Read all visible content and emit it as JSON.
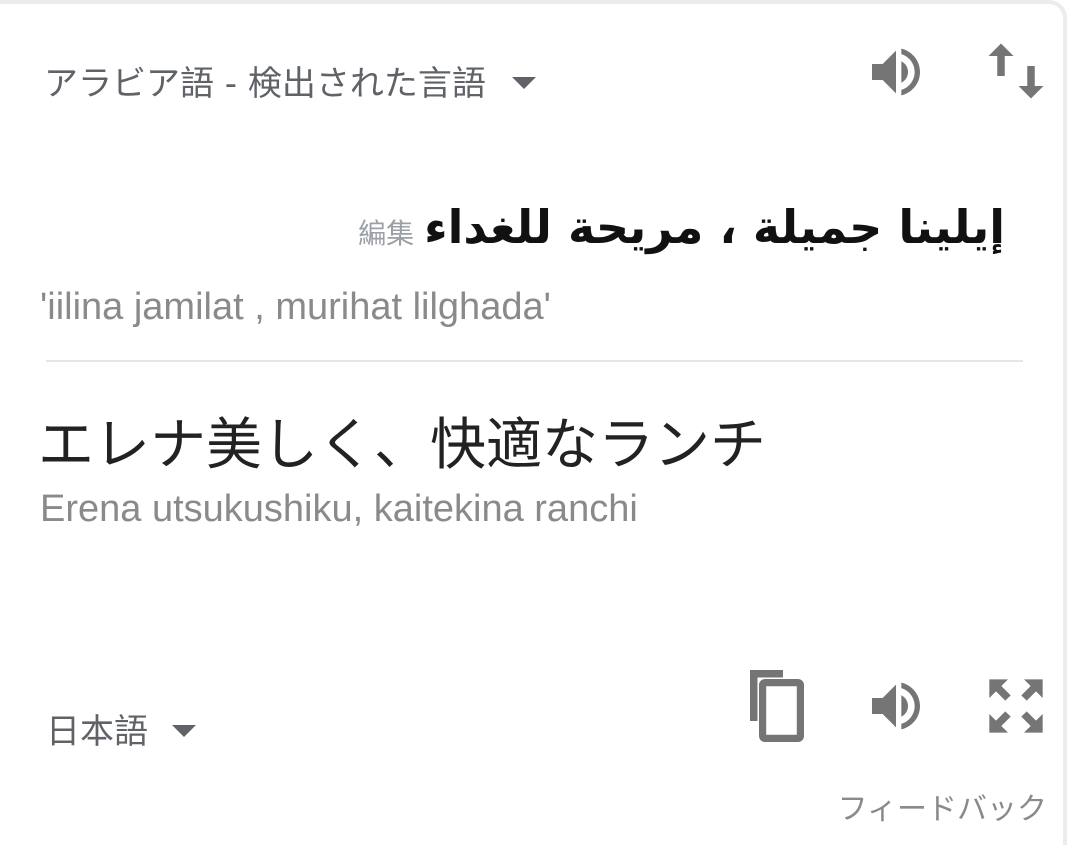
{
  "source": {
    "language_label": "アラビア語 - 検出された言語",
    "text": "إيلينا جميلة ، مريحة للغداء",
    "edit_label": "編集",
    "transliteration": "'iilina jamilat , murihat lilghada'"
  },
  "target": {
    "language_label": "日本語",
    "text": "エレナ美しく、快適なランチ",
    "transliteration": "Erena utsukushiku, kaitekina ranchi"
  },
  "footer": {
    "feedback_label": "フィードバック"
  },
  "icons": {
    "source_speaker": "speaker-icon",
    "swap": "swap-icon",
    "copy": "copy-icon",
    "target_speaker": "speaker-icon",
    "expand": "fullscreen-icon"
  },
  "colors": {
    "icon_gray": "#757575",
    "text_primary": "#222222",
    "text_secondary": "#8a8a8a",
    "label_gray": "#5f6368"
  }
}
